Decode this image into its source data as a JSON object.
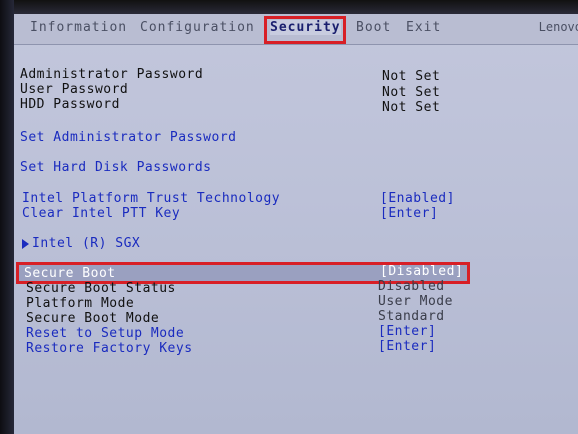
{
  "menu": {
    "tabs": [
      {
        "label": "Information"
      },
      {
        "label": "Configuration"
      },
      {
        "label": "Security"
      },
      {
        "label": "Boot"
      },
      {
        "label": "Exit"
      }
    ],
    "copyright": "Lenovo"
  },
  "passwords": [
    {
      "label": "Administrator Password",
      "value": "Not Set"
    },
    {
      "label": "User Password",
      "value": "Not Set"
    },
    {
      "label": "HDD Password",
      "value": "Not Set"
    }
  ],
  "actions": {
    "set_admin": "Set Administrator Password",
    "set_hdd": "Set Hard Disk Passwords"
  },
  "ptt": [
    {
      "label": "Intel Platform Trust Technology",
      "value": "[Enabled]"
    },
    {
      "label": "Clear Intel PTT Key",
      "value": "[Enter]"
    }
  ],
  "sgx": {
    "label": "Intel (R) SGX"
  },
  "secure_boot": [
    {
      "label": "Secure Boot",
      "value": "[Disabled]"
    },
    {
      "label": "Secure Boot Status",
      "value": "Disabled"
    },
    {
      "label": "Platform Mode",
      "value": "User Mode"
    },
    {
      "label": "Secure Boot Mode",
      "value": "Standard"
    },
    {
      "label": "Reset to Setup Mode",
      "value": "[Enter]"
    },
    {
      "label": "Restore Factory Keys",
      "value": "[Enter]"
    }
  ]
}
